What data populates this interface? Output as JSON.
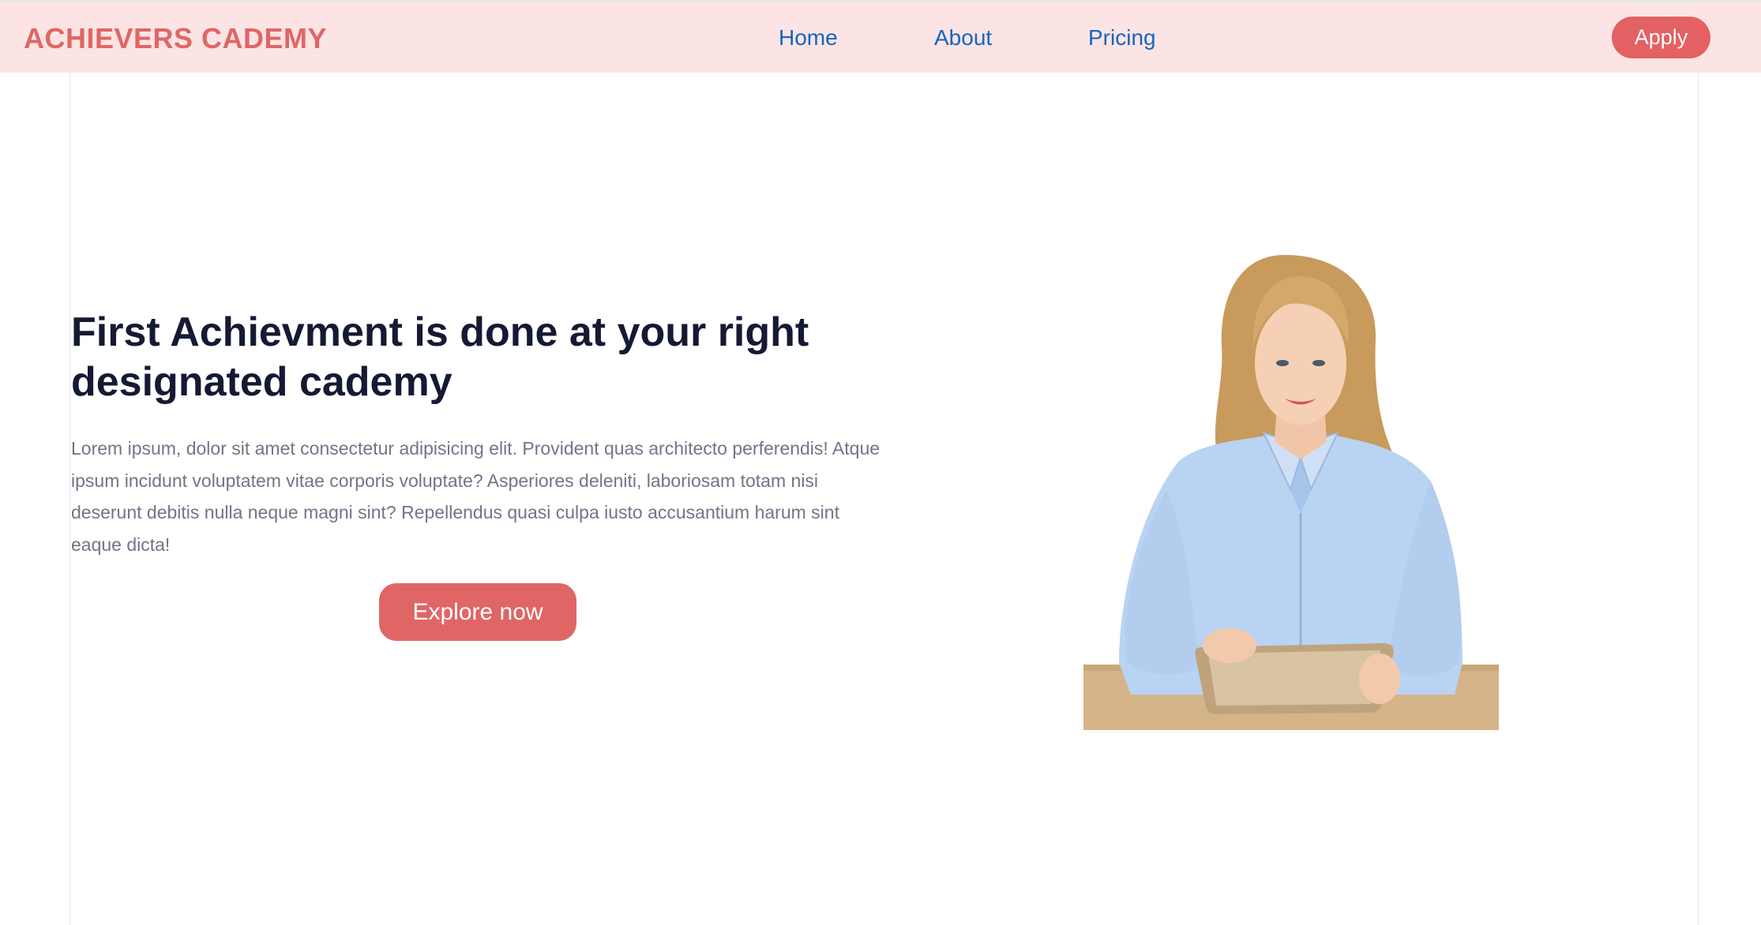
{
  "brand": {
    "name": "ACHIEVERS CADEMY"
  },
  "nav": {
    "links": [
      {
        "label": "Home"
      },
      {
        "label": "About"
      },
      {
        "label": "Pricing"
      }
    ],
    "apply_label": "Apply"
  },
  "hero": {
    "title": "First Achievment is done at your right designated cademy",
    "body": "Lorem ipsum, dolor sit amet consectetur adipisicing elit. Provident quas architecto perferendis! Atque ipsum incidunt voluptatem vitae corporis voluptate? Asperiores deleniti, laboriosam totam nisi deserunt debitis nulla neque magni sint? Repellendus quasi culpa iusto accusantium harum sint eaque dicta!",
    "cta_label": "Explore now"
  },
  "colors": {
    "navbar_bg": "#fce4e4",
    "brand": "#e06666",
    "nav_link": "#1565c0",
    "button": "#e36162",
    "title": "#141a33",
    "body_text": "#6f7687"
  }
}
